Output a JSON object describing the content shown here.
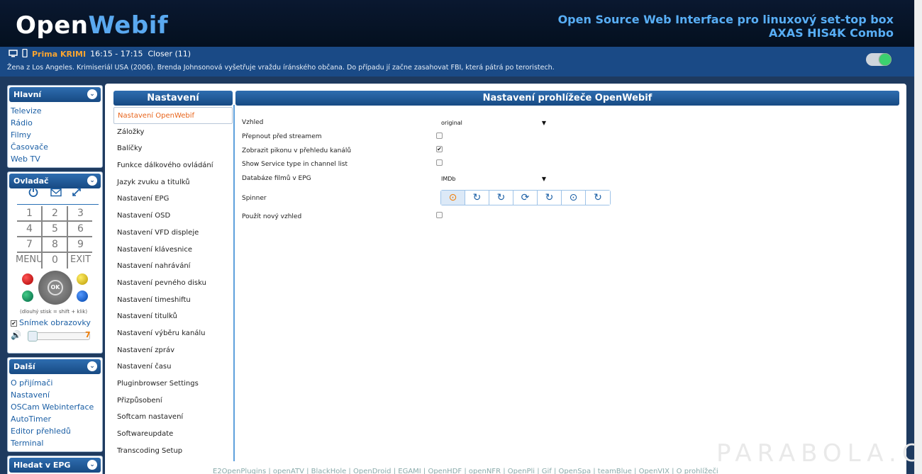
{
  "header": {
    "logo_open": "Open",
    "logo_webif": "Webif",
    "tagline1": "Open Source Web Interface pro linuxový set-top box",
    "tagline2": "AXAS HIS4K Combo"
  },
  "now": {
    "channel": "Prima KRIMI",
    "time": "16:15 - 17:15",
    "title": "Closer (11)",
    "description": "Žena z Los Angeles. Krimiseriál USA (2006). Brenda Johnsonová vyšetřuje vraždu íránského občana. Do případu jí začne zasahovat FBI, která pátrá po teroristech."
  },
  "sidebar": {
    "main": {
      "title": "Hlavní",
      "items": [
        "Televize",
        "Rádio",
        "Filmy",
        "Časovače",
        "Web TV"
      ]
    },
    "remote": {
      "title": "Ovladač",
      "keys": [
        "1",
        "2",
        "3",
        "4",
        "5",
        "6",
        "7",
        "8",
        "9",
        "MENU",
        "0",
        "EXIT"
      ],
      "ok": "OK",
      "hint": "(dlouhý stisk = shift + klik)",
      "snapshot": "Snímek obrazovky",
      "volume": "7"
    },
    "other": {
      "title": "Další",
      "items": [
        "O přijímači",
        "Nastavení",
        "OSCam Webinterface",
        "AutoTimer",
        "Editor přehledů",
        "Terminal"
      ]
    },
    "epg": {
      "title": "Hledat v EPG"
    }
  },
  "menu": {
    "title": "Nastavení",
    "items": [
      "Nastavení OpenWebif",
      "Záložky",
      "Balíčky",
      "Funkce dálkového ovládání",
      "Jazyk zvuku a titulků",
      "Nastavení EPG",
      "Nastavení OSD",
      "Nastavení VFD displeje",
      "Nastavení klávesnice",
      "Nastavení nahrávání",
      "Nastavení pevného disku",
      "Nastavení timeshiftu",
      "Nastavení titulků",
      "Nastavení výběru kanálu",
      "Nastavení zpráv",
      "Nastavení času",
      "Pluginbrowser Settings",
      "Přizpůsobení",
      "Softcam nastavení",
      "Softwareupdate",
      "Transcoding Setup"
    ]
  },
  "content": {
    "title": "Nastavení prohlížeče OpenWebif",
    "rows": {
      "skin": "Vzhled",
      "skin_value": "original",
      "switch_before_stream": "Přepnout před streamem",
      "show_picon": "Zobrazit pikonu v přehledu kanálů",
      "show_service_type": "Show Service type in channel list",
      "movie_db": "Databáze filmů v EPG",
      "movie_db_value": "IMDb",
      "spinner": "Spinner",
      "new_look": "Použít nový vzhled"
    },
    "checked": {
      "switch_before_stream": false,
      "show_picon": true,
      "show_service_type": false,
      "new_look": false
    }
  },
  "footer": "E2OpenPlugins | openATV | BlackHole | OpenDroid | EGAMI | OpenHDF | openNFR | OpenPli | Gif | OpenSpa | teamBlue | OpenVIX | O prohlížeči",
  "watermark": "PARABOLA.CZ",
  "colors": {
    "header": "#04101f",
    "nowbar": "#1a4a86",
    "accent": "#e8641b",
    "link": "#1b5fa5"
  }
}
